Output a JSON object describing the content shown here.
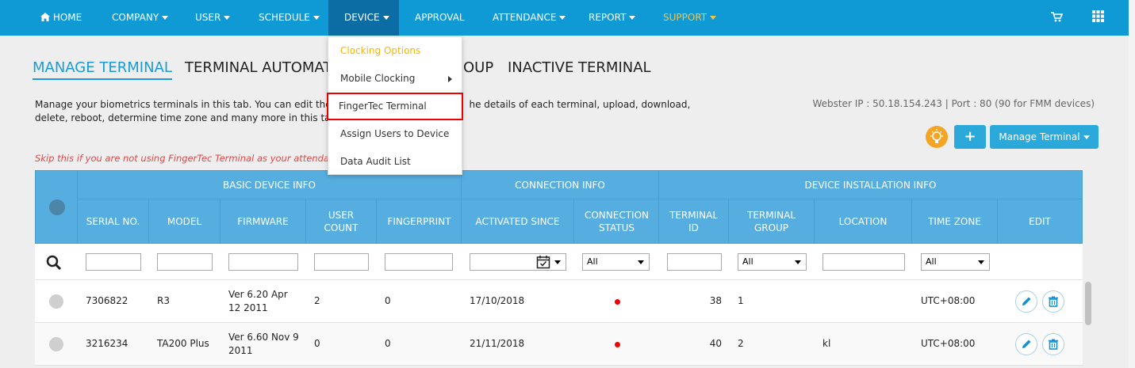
{
  "nav": {
    "home": "HOME",
    "company": "COMPANY",
    "user": "USER",
    "schedule": "SCHEDULE",
    "device": "DEVICE",
    "approval": "APPROVAL",
    "attendance": "ATTENDANCE",
    "report": "REPORT",
    "support": "SUPPORT",
    "support_color": "#f5c342"
  },
  "device_menu": {
    "items": [
      "Clocking Options",
      "Mobile Clocking",
      "FingerTec Terminal",
      "Assign Users to Device",
      "Data Audit List"
    ],
    "selected": "FingerTec Terminal"
  },
  "tabs": [
    "MANAGE TERMINAL",
    "TERMINAL AUTOMATI",
    "OUP",
    "INACTIVE TERMINAL"
  ],
  "description": "Manage your biometrics terminals in this tab. You can edit the ",
  "description_tail": "he details of each terminal, upload, download, delete, reboot, determine time zone and many more in this tab.",
  "webster_info": "Webster IP : 50.18.154.243 | Port : 80 (90 for FMM devices)",
  "warning": "Skip this if you are not using FingerTec Terminal as your attenda",
  "actions": {
    "add": "+",
    "manage": "Manage Terminal"
  },
  "table": {
    "groups": [
      "BASIC DEVICE INFO",
      "CONNECTION INFO",
      "DEVICE INSTALLATION INFO"
    ],
    "columns": [
      "SERIAL NO.",
      "MODEL",
      "FIRMWARE",
      "USER COUNT",
      "FINGERPRINT",
      "ACTIVATED SINCE",
      "CONNECTION STATUS",
      "TERMINAL ID",
      "TERMINAL GROUP",
      "LOCATION",
      "TIME ZONE",
      "EDIT"
    ],
    "filters": {
      "status": "All",
      "group": "All",
      "timezone": "All"
    },
    "rows": [
      {
        "serial": "7306822",
        "model": "R3",
        "firmware": "Ver 6.20 Apr 12 2011",
        "user_count": "2",
        "fingerprint": "0",
        "activated": "17/10/2018",
        "status": "offline",
        "terminal_id": "38",
        "group": "1",
        "location": "",
        "timezone": "UTC+08:00"
      },
      {
        "serial": "3216234",
        "model": "TA200 Plus",
        "firmware": "Ver 6.60 Nov 9 2011",
        "user_count": "0",
        "fingerprint": "0",
        "activated": "21/11/2018",
        "status": "offline",
        "terminal_id": "40",
        "group": "2",
        "location": "kl",
        "timezone": "UTC+08:00"
      }
    ]
  },
  "colors": {
    "nav_bg": "#0f9ad6",
    "active": "#1a9bd7",
    "header": "#56aee0",
    "warning": "#e64545",
    "status_dot": "#e00000"
  }
}
